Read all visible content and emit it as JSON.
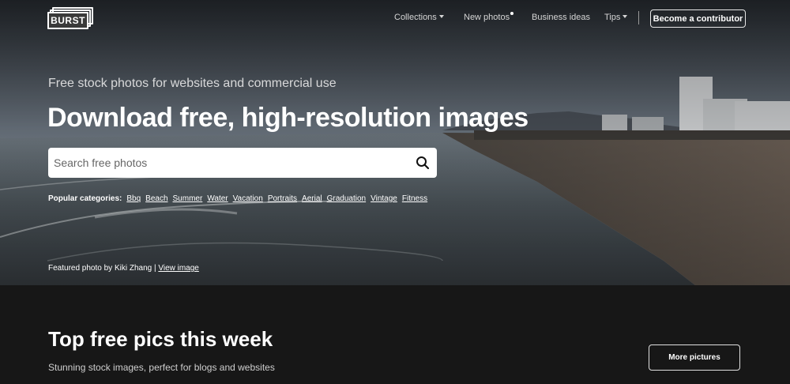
{
  "nav": {
    "logo_text": "BURST",
    "links": [
      {
        "label": "Collections",
        "has_dropdown": true
      },
      {
        "label": "New photos",
        "has_indicator_dot": true
      },
      {
        "label": "Business ideas"
      },
      {
        "label": "Tips",
        "has_dropdown": true
      }
    ],
    "contributor_button": "Become a contributor"
  },
  "hero": {
    "tagline": "Free stock photos for websites and commercial use",
    "headline": "Download free, high-resolution images",
    "search": {
      "placeholder": "Search free photos",
      "value": "",
      "icon": "search-icon"
    },
    "categories_label": "Popular categories:",
    "categories": [
      "Bbq",
      "Beach",
      "Summer",
      "Water",
      "Vacation",
      "Portraits",
      "Aerial",
      "Graduation",
      "Vintage",
      "Fitness"
    ],
    "credit_text": "Featured photo by Kiki Zhang |",
    "credit_link": "View image"
  },
  "section": {
    "title": "Top free pics this week",
    "subtitle": "Stunning stock images, perfect for blogs and websites",
    "more_button": "More pictures"
  },
  "colors": {
    "footer_bg": "#171717",
    "text": "#ffffff"
  }
}
